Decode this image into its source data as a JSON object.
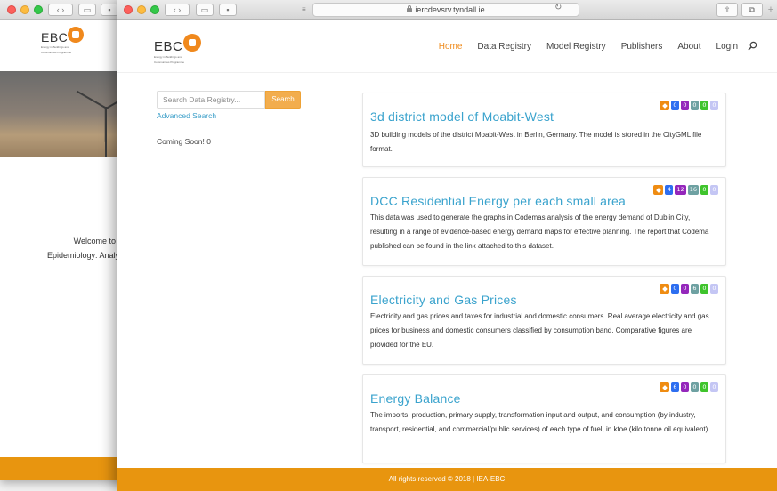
{
  "back_window": {
    "logo": "EBC",
    "logo_sub_line1": "Energy in Buildings and",
    "logo_sub_line2": "Communities Programme",
    "welcome_line1": "Welcome to the",
    "welcome_line2": "Epidemiology: Analysis"
  },
  "browser": {
    "url": "iercdevsrv.tyndall.ie"
  },
  "site": {
    "logo": "EBC",
    "logo_sub_line1": "Energy in Buildings and",
    "logo_sub_line2": "Communities Programme",
    "nav": [
      "Home",
      "Data Registry",
      "Model Registry",
      "Publishers",
      "About",
      "Login"
    ],
    "active_nav": "Home",
    "accent_color": "#ef8a1a"
  },
  "sidebar": {
    "search_placeholder": "Search Data Registry...",
    "search_button": "Search",
    "advanced_search": "Advanced Search",
    "coming_soon": "Coming Soon! 0"
  },
  "datasets": [
    {
      "title": "3d district model of Moabit-West",
      "description": "3D building models of the district Moabit-West in Berlin, Germany. The model is stored in the CityGML file format.",
      "badges": [
        "0",
        "0",
        "0",
        "0",
        "0"
      ]
    },
    {
      "title": "DCC Residential Energy per each small area",
      "description": "This data was used to generate the graphs in Codemas analysis of the energy demand of Dublin City, resulting in a range of evidence-based energy demand maps for effective planning. The report that Codema published can be found in the link attached to this dataset.",
      "badges": [
        "4",
        "12",
        "16",
        "0",
        "0"
      ]
    },
    {
      "title": "Electricity and Gas Prices",
      "description": "Electricity and gas prices and taxes for industrial and domestic consumers. Real average electricity and gas prices for business and domestic consumers classified by consumption band. Comparative figures are provided for the EU.",
      "badges": [
        "0",
        "0",
        "6",
        "0",
        "0"
      ]
    },
    {
      "title": "Energy Balance",
      "description": "The imports, production, primary supply, transformation input and output, and consumption (by industry, transport, residential, and commercial/public services) of each type of fuel, in ktoe (kilo tonne oil equivalent).",
      "badges": [
        "6",
        "0",
        "0",
        "0",
        "0"
      ]
    }
  ],
  "footer": {
    "text": "All rights reserved © 2018 | IEA-EBC"
  }
}
